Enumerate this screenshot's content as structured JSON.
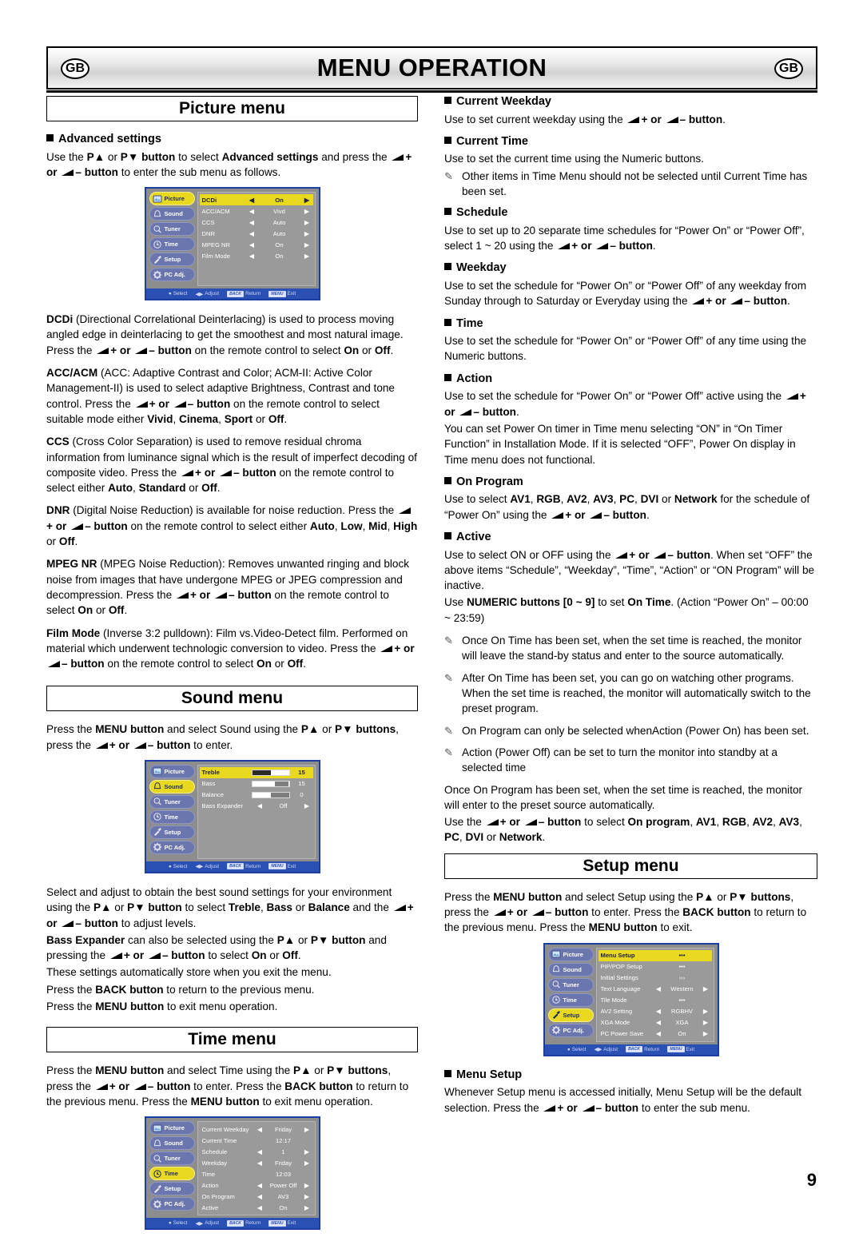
{
  "header": {
    "title": "MENU OPERATION",
    "badge_left": "GB",
    "badge_right": "GB"
  },
  "page_number": "9",
  "osd_footer": {
    "select": "Select",
    "adjust": "Adjust",
    "back_key": "BACK",
    "return": "Return",
    "menu_key": "MENU",
    "exit": "Exit"
  },
  "osd_sidebar": [
    {
      "label": "Picture",
      "icon": "picture-icon"
    },
    {
      "label": "Sound",
      "icon": "bell-icon"
    },
    {
      "label": "Tuner",
      "icon": "magnifier-icon"
    },
    {
      "label": "Time",
      "icon": "clock-icon"
    },
    {
      "label": "Setup",
      "icon": "hammer-icon"
    },
    {
      "label": "PC Adj.",
      "icon": "gear-icon"
    }
  ],
  "picture_section": {
    "title": "Picture menu",
    "advanced_heading": "Advanced settings",
    "advanced_intro_a": "Use the ",
    "advanced_intro_b": "P▲",
    "advanced_intro_c": " or ",
    "advanced_intro_d": "P▼ button",
    "advanced_intro_e": " to select ",
    "advanced_intro_f": "Advanced settings",
    "advanced_intro_g": " and press the ",
    "advanced_intro_h": "+ or ",
    "advanced_intro_i": "– button",
    "advanced_intro_j": " to enter the sub menu as follows.",
    "osd_rows": [
      {
        "label": "DCDi",
        "value": "On",
        "selected": true
      },
      {
        "label": "ACC/ACM",
        "value": "Vivd",
        "selected": false
      },
      {
        "label": "CCS",
        "value": "Auto",
        "selected": false
      },
      {
        "label": "DNR",
        "value": "Auto",
        "selected": false
      },
      {
        "label": "MPEG NR",
        "value": "On",
        "selected": false
      },
      {
        "label": "Film Mode",
        "value": "On",
        "selected": false
      }
    ],
    "paragraphs": {
      "dcdi": {
        "term": "DCDi",
        "p1": " (Directional Correlational Deinterlacing) is used to process moving angled edge in deinterlacing to get the smoothest and most natural image. Press the ",
        "p2": "+ or ",
        "p3": "– button",
        "p4": " on the remote control to select ",
        "o1": "On",
        "p5": " or ",
        "o2": "Off",
        "p6": "."
      },
      "accacm": {
        "term": "ACC/ACM",
        "p1": " (ACC: Adaptive Contrast and Color; ACM-II: Active Color Management-II) is used to select adaptive Brightness, Contrast and tone control. Press the ",
        "p2": "+ or ",
        "p3": "– button",
        "p4": " on the remote control to select suitable mode either ",
        "o1": "Vivid",
        "sep1": ", ",
        "o2": "Cinema",
        "sep2": ", ",
        "o3": "Sport",
        "sep3": " or ",
        "o4": "Off",
        "p5": "."
      },
      "ccs": {
        "term": "CCS",
        "p1": " (Cross Color Separation) is used to remove residual chroma information from luminance signal which is the result of imperfect decoding of composite video. Press the ",
        "p2": "+ or ",
        "p3": "– button",
        "p4": " on the remote control to select either ",
        "o1": "Auto",
        "sep1": ", ",
        "o2": "Standard",
        "sep2": " or ",
        "o3": "Off",
        "p5": "."
      },
      "dnr": {
        "term": "DNR",
        "p1": " (Digital Noise Reduction) is available for noise reduction. Press the ",
        "p2": "+ or ",
        "p3": "– button",
        "p4": " on the remote control to select either ",
        "o1": "Auto",
        "sep1": ", ",
        "o2": "Low",
        "sep2": ", ",
        "o3": "Mid",
        "sep3": ", ",
        "o4": "High",
        "sep4": " or ",
        "o5": "Off",
        "p5": "."
      },
      "mpegnr": {
        "term": "MPEG NR",
        "p1": " (MPEG Noise Reduction): Removes unwanted ringing and block noise from images that have undergone MPEG or JPEG compression and decompression. Press the ",
        "p2": "+ or ",
        "p3": "– button",
        "p4": " on the remote control to select ",
        "o1": "On",
        "sep1": " or ",
        "o2": "Off",
        "p5": "."
      },
      "filmmode": {
        "term": "Film Mode",
        "p1": " (Inverse 3:2 pulldown): Film vs.Video-Detect film. Performed on material which underwent technologic conversion to video. Press the ",
        "p2": "+ or ",
        "p3": "– button",
        "p4": " on the remote control to select ",
        "o1": "On",
        "sep1": " or ",
        "o2": "Off",
        "p5": "."
      }
    }
  },
  "sound_section": {
    "title": "Sound menu",
    "intro": {
      "a": "Press the ",
      "b": "MENU button",
      "c": " and select Sound using the ",
      "d": "P▲",
      "e": " or ",
      "f": "P▼ buttons",
      "g": ", press the ",
      "h": "+ or ",
      "i": "– button",
      "j": " to enter."
    },
    "osd_rows": [
      {
        "label": "Treble",
        "type": "bar",
        "fill": 52,
        "num": "15",
        "selected": true
      },
      {
        "label": "Bass",
        "type": "bar",
        "fill": 62,
        "num": "15",
        "selected": false
      },
      {
        "label": "Balance",
        "type": "bar",
        "fill": 50,
        "num": "0",
        "selected": false
      },
      {
        "label": "Bass Expander",
        "type": "option",
        "value": "Off",
        "selected": false
      }
    ],
    "body": {
      "a": "Select and adjust to obtain the best sound settings for your environment using the ",
      "b": "P▲",
      "c": " or ",
      "d": "P▼ button",
      "e": " to select ",
      "f": "Treble",
      "g": ", ",
      "h": "Bass",
      "i": " or ",
      "j": "Balance",
      "k": " and the ",
      "l": "+ or ",
      "m": "– button",
      "n": " to adjust levels.",
      "o": "Bass Expander",
      "p": " can also be selected using the ",
      "q": "P▲",
      "r": " or ",
      "s": "P▼ button",
      "t": " and pressing the ",
      "u": "+ or ",
      "v": "– button",
      "w": " to select ",
      "x": "On",
      "y": " or ",
      "z": "Off",
      "aa": ".",
      "line3": "These settings automatically store when you exit the menu.",
      "line4a": "Press the ",
      "line4b": "BACK button",
      "line4c": " to return to the previous menu.",
      "line5a": "Press the ",
      "line5b": "MENU button",
      "line5c": " to exit menu operation."
    }
  },
  "time_section": {
    "title": "Time menu",
    "intro": {
      "a": "Press the ",
      "b": "MENU button",
      "c": " and select Time using the ",
      "d": "P▲",
      "e": " or ",
      "f": "P▼ buttons",
      "g": ", press the ",
      "h": "+ or ",
      "i": "– button",
      "j": " to enter. Press the ",
      "k": "BACK button",
      "l": " to return to the previous menu. Press the ",
      "m": "MENU button",
      "n": " to exit menu operation."
    },
    "osd_rows": [
      {
        "label": "Current Weekday",
        "value": "Friday",
        "arrows": true,
        "selected": false
      },
      {
        "label": "Current Time",
        "value": "12:17",
        "arrows": false,
        "selected": false
      },
      {
        "label": "Schedule",
        "value": "1",
        "arrows": true,
        "selected": false
      },
      {
        "label": "Weekday",
        "value": "Friday",
        "arrows": true,
        "selected": false
      },
      {
        "label": "Time",
        "value": "12:03",
        "arrows": false,
        "selected": false
      },
      {
        "label": "Action",
        "value": "Power Off",
        "arrows": true,
        "selected": false
      },
      {
        "label": "On Program",
        "value": "AV3",
        "arrows": true,
        "selected": false
      },
      {
        "label": "Active",
        "value": "On",
        "arrows": true,
        "selected": false
      }
    ]
  },
  "setup_section": {
    "title": "Setup menu",
    "intro": {
      "a": "Press the ",
      "b": "MENU button",
      "c": " and select Setup using the ",
      "d": "P▲",
      "e": " or ",
      "f": "P▼ buttons",
      "g": ", press the ",
      "h": "+ or ",
      "i": "– button",
      "j": " to enter. Press the ",
      "k": "BACK button",
      "l": " to return to the previous menu. Press the ",
      "m": "MENU button",
      "n": " to exit."
    },
    "osd_rows": [
      {
        "label": "Menu Setup",
        "value": "•••",
        "arrows": false,
        "selected": true
      },
      {
        "label": "PIP/POP Setup",
        "value": "•••",
        "arrows": false,
        "selected": false
      },
      {
        "label": "Initial Settings",
        "value": "›››",
        "arrows": false,
        "selected": false
      },
      {
        "label": "Text Language",
        "value": "Western",
        "arrows": true,
        "selected": false
      },
      {
        "label": "Tile Mode",
        "value": "•••",
        "arrows": false,
        "selected": false
      },
      {
        "label": "AV2 Setting",
        "value": "RGBHV",
        "arrows": true,
        "selected": false
      },
      {
        "label": "XGA Mode",
        "value": "XGA",
        "arrows": true,
        "selected": false
      },
      {
        "label": "PC Power Save",
        "value": "On",
        "arrows": true,
        "selected": false
      }
    ],
    "menu_setup_heading": "Menu Setup",
    "menu_setup_body": {
      "a": "Whenever Setup menu is accessed initially, Menu Setup will be the default selection. Press the ",
      "b": "+ or ",
      "c": "– button",
      "d": " to enter the sub menu."
    }
  },
  "right_column": {
    "current_weekday": {
      "heading": "Current Weekday",
      "a": "Use to set current weekday using the ",
      "b": "+ or ",
      "c": "– button",
      "d": "."
    },
    "current_time": {
      "heading": "Current Time",
      "body": "Use to set the current time using the Numeric buttons.",
      "note": "Other items in Time Menu should not be selected until Current Time has been set."
    },
    "schedule": {
      "heading": "Schedule",
      "a": "Use to set up to 20 separate time schedules for “Power On” or “Power Off”, select 1 ~ 20 using the ",
      "b": "+ or ",
      "c": "– button",
      "d": "."
    },
    "weekday": {
      "heading": "Weekday",
      "a": "Use to set the schedule for “Power On” or “Power Off” of any weekday from Sunday through to Saturday or Everyday using the ",
      "b": "+ or ",
      "c": "–",
      "d": " ",
      "e": "button",
      "f": "."
    },
    "time": {
      "heading": "Time",
      "body": "Use to set the schedule for “Power On” or “Power Off” of any time using the Numeric buttons."
    },
    "action": {
      "heading": "Action",
      "a": "Use to set the schedule for “Power On” or “Power Off” active using the ",
      "b": "+ or ",
      "c": "– button",
      "d": ".",
      "body2": "You can set Power On timer in Time menu selecting “ON” in “On Timer Function” in Installation Mode. If it is selected “OFF”, Power On display in Time menu does not functional."
    },
    "on_program": {
      "heading": "On Program",
      "a": "Use to select ",
      "o1": "AV1",
      "s1": ", ",
      "o2": "RGB",
      "s2": ", ",
      "o3": "AV2",
      "s3": ", ",
      "o4": "AV3",
      "s4": ", ",
      "o5": "PC",
      "s5": ", ",
      "o6": "DVI",
      "s6": " or ",
      "o7": "Network",
      "b": " for the schedule of “Power On” using the ",
      "c": "+ or ",
      "d": "– button",
      "e": "."
    },
    "active": {
      "heading": "Active",
      "a": "Use to select ON or OFF using the ",
      "b": "+ or ",
      "c": "– button",
      "d": ". When set “OFF” the above items “Schedule”, “Weekday”, “Time”, “Action” or “ON Program” will be inactive.",
      "e": "Use ",
      "f": "NUMERIC buttons [0 ~ 9]",
      "g": " to set ",
      "h": "On Time",
      "i": ". (Action “Power On” – 00:00 ~ 23:59)",
      "note1": "Once On Time has been set, when the set time is reached, the monitor will leave the stand-by status and enter to the source automatically.",
      "note2": "After On Time has been set, you can go on watching other programs. When the set time is reached, the monitor will automatically switch to the preset program.",
      "note3": "On Program can only be selected whenAction (Power On) has been set.",
      "note4": "Action (Power Off) can be set to turn the monitor into standby at a selected time",
      "tail1": "Once On Program has been set, when the set time is reached, the monitor will enter to the preset source automatically.",
      "tail2a": "Use the ",
      "tail2b": "+ or ",
      "tail2c": "– button",
      "tail2d": " to select ",
      "t1": "On program",
      "ts1": ", ",
      "t2": "AV1",
      "ts2": ", ",
      "t3": "RGB",
      "ts3": ", ",
      "t4": "AV2",
      "ts4": ", ",
      "t5": "AV3",
      "ts5": ", ",
      "t6": "PC",
      "ts6": ", ",
      "t7": "DVI",
      "ts7": " or ",
      "t8": "Network",
      "tail2e": "."
    }
  }
}
